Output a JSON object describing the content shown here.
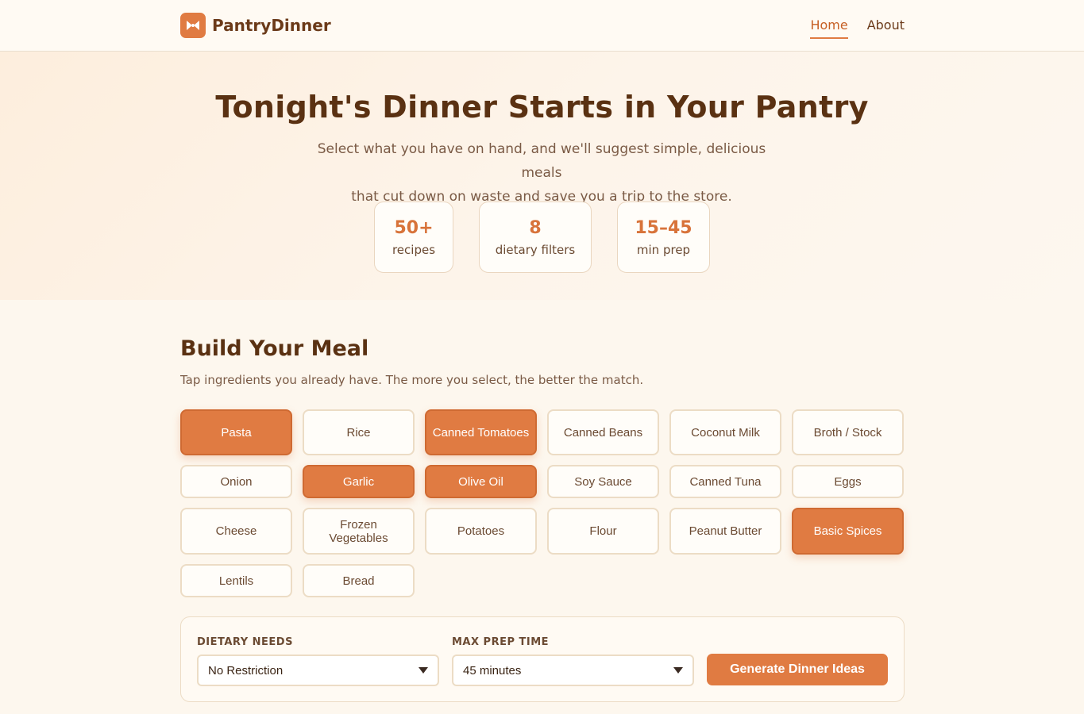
{
  "brand": {
    "name": "PantryDinner",
    "logo_icon": "bowtie-icon"
  },
  "nav": {
    "home": "Home",
    "about": "About"
  },
  "hero": {
    "title": "Tonight's Dinner Starts in Your Pantry",
    "subtitle_line1": "Select what you have on hand, and we'll suggest simple, delicious meals",
    "subtitle_line2": "that cut down on waste and save you a trip to the store.",
    "stats": [
      {
        "value": "50+",
        "label": "recipes"
      },
      {
        "value": "8",
        "label": "dietary filters"
      },
      {
        "value": "15–45",
        "label": "min prep"
      }
    ]
  },
  "builder": {
    "title": "Build Your Meal",
    "description": "Tap ingredients you already have. The more you select, the better the match.",
    "ingredients": [
      {
        "label": "Pasta",
        "selected": true
      },
      {
        "label": "Rice",
        "selected": false
      },
      {
        "label": "Canned Tomatoes",
        "selected": true
      },
      {
        "label": "Canned Beans",
        "selected": false
      },
      {
        "label": "Coconut Milk",
        "selected": false
      },
      {
        "label": "Broth / Stock",
        "selected": false
      },
      {
        "label": "Onion",
        "selected": false
      },
      {
        "label": "Garlic",
        "selected": true
      },
      {
        "label": "Olive Oil",
        "selected": true
      },
      {
        "label": "Soy Sauce",
        "selected": false
      },
      {
        "label": "Canned Tuna",
        "selected": false
      },
      {
        "label": "Eggs",
        "selected": false
      },
      {
        "label": "Cheese",
        "selected": false
      },
      {
        "label": "Frozen Vegetables",
        "selected": false
      },
      {
        "label": "Potatoes",
        "selected": false
      },
      {
        "label": "Flour",
        "selected": false
      },
      {
        "label": "Peanut Butter",
        "selected": false
      },
      {
        "label": "Basic Spices",
        "selected": true
      },
      {
        "label": "Lentils",
        "selected": false
      },
      {
        "label": "Bread",
        "selected": false
      }
    ]
  },
  "controls": {
    "dietary_label": "DIETARY NEEDS",
    "dietary_value": "No Restriction",
    "prep_label": "MAX PREP TIME",
    "prep_value": "45 minutes",
    "generate_label": "Generate Dinner Ideas"
  },
  "colors": {
    "accent": "#e07b42",
    "text_dark": "#5a3112",
    "background": "#fdf7ee"
  }
}
